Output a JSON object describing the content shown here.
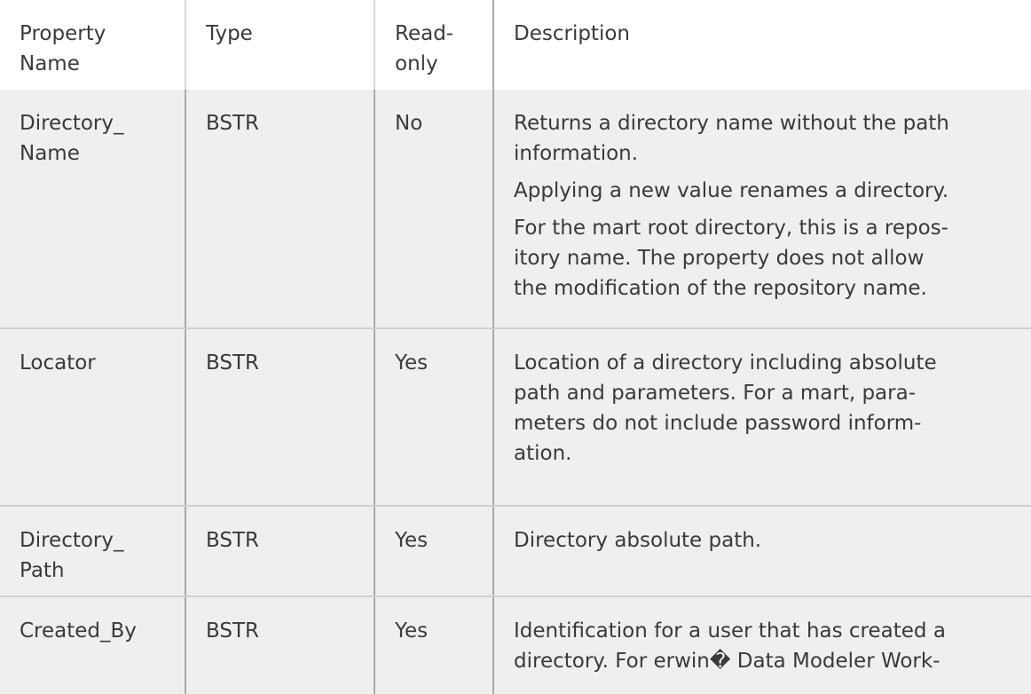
{
  "table": {
    "headers": [
      "Property Name",
      "Type",
      "Read-only",
      "Description"
    ],
    "header_lines": {
      "property_name": [
        "Property",
        "Name"
      ],
      "type": [
        "Type"
      ],
      "read_only": [
        "Read-",
        "only"
      ],
      "description": [
        "Description"
      ]
    },
    "rows": [
      {
        "name_lines": [
          "Directory_",
          "Name"
        ],
        "type": "BSTR",
        "read_only": "No",
        "description_paragraphs": [
          [
            "Returns a directory name without the path",
            "information."
          ],
          [
            "Applying a new value renames a directory."
          ],
          [
            "For the mart root directory, this is a repos-",
            "itory name. The property does not allow",
            "the modification of the repository name."
          ]
        ]
      },
      {
        "name_lines": [
          "Locator"
        ],
        "type": "BSTR",
        "read_only": "Yes",
        "description_paragraphs": [
          [
            "Location of a directory including absolute",
            "path and parameters. For a mart, para-",
            "meters do not include password inform-",
            "ation."
          ]
        ]
      },
      {
        "name_lines": [
          "Directory_",
          "Path"
        ],
        "type": "BSTR",
        "read_only": "Yes",
        "description_paragraphs": [
          [
            "Directory absolute path."
          ]
        ]
      },
      {
        "name_lines": [
          "Created_By"
        ],
        "type": "BSTR",
        "read_only": "Yes",
        "description_paragraphs": [
          [
            "Identification for a user that has created a",
            "directory. For erwin� Data Modeler Work-"
          ]
        ]
      }
    ]
  },
  "colors": {
    "row_background": "#efefef",
    "header_background": "#ffffff",
    "text": "#3a3a3a",
    "separator": "#a9a9a9"
  }
}
